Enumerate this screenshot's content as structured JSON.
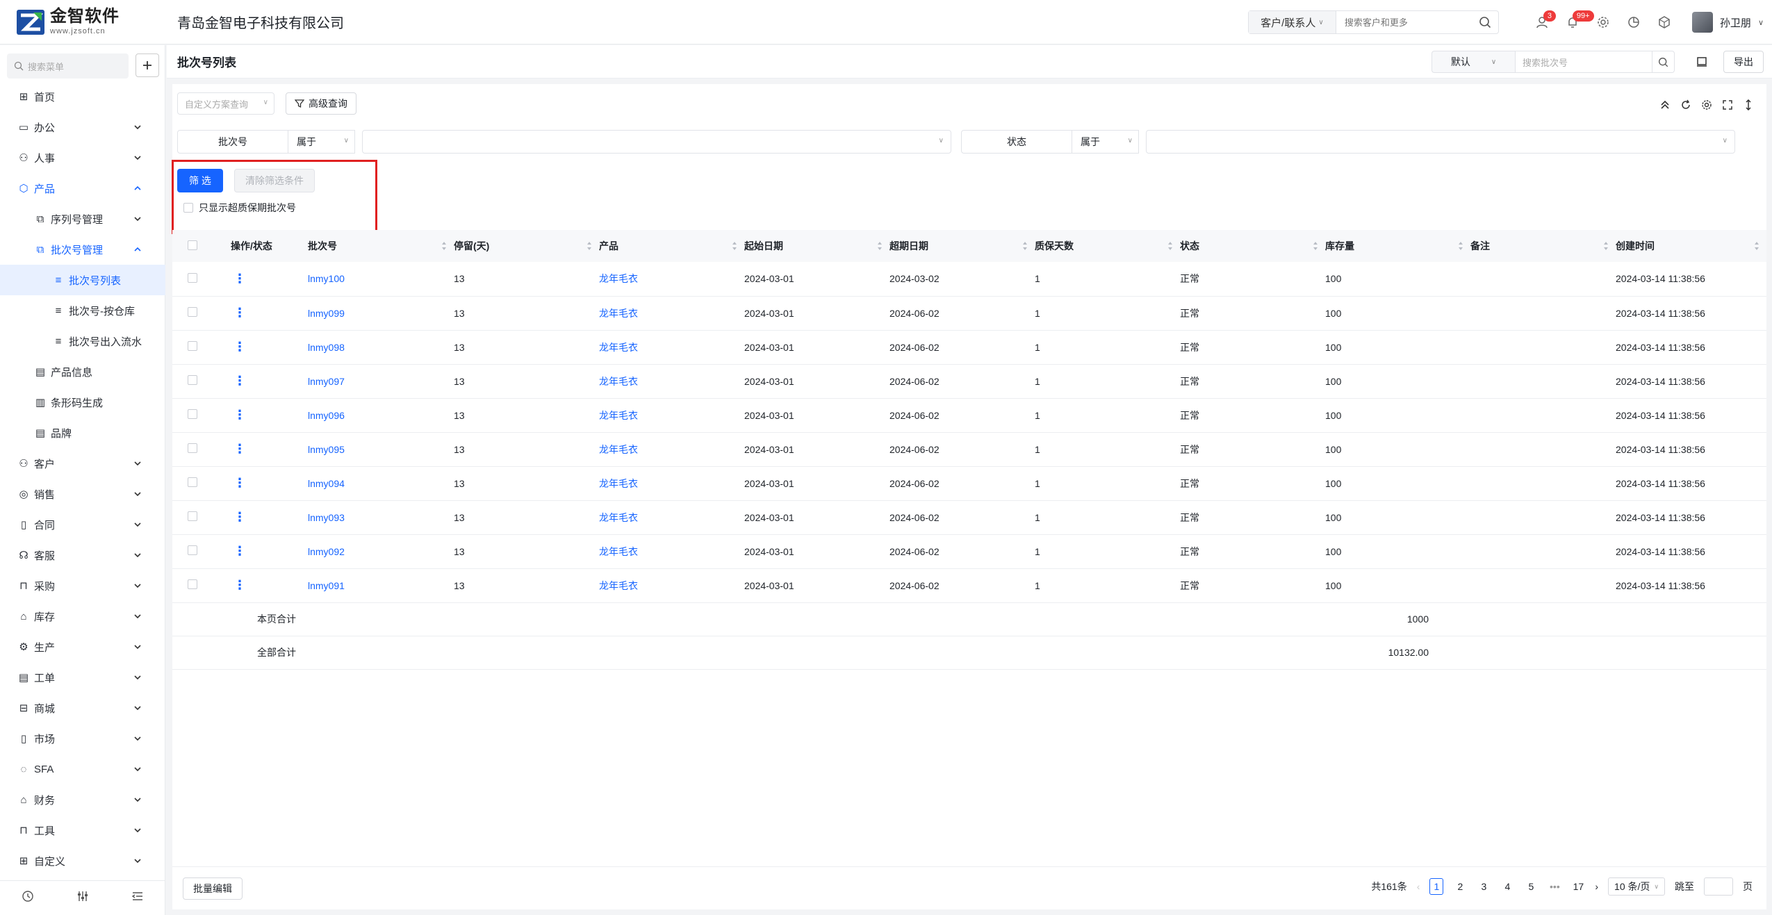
{
  "header": {
    "logo_cn": "金智软件",
    "logo_en": "www.jzsoft.cn",
    "company": "青岛金智电子科技有限公司",
    "search_scope": "客户/联系人",
    "search_placeholder": "搜索客户和更多",
    "badge_contacts": "3",
    "badge_notify": "99+",
    "user_name": "孙卫朋"
  },
  "sidebar": {
    "search_placeholder": "搜索菜单",
    "items": [
      {
        "label": "首页"
      },
      {
        "label": "办公"
      },
      {
        "label": "人事"
      },
      {
        "label": "产品"
      },
      {
        "label": "序列号管理"
      },
      {
        "label": "批次号管理"
      },
      {
        "label": "批次号列表"
      },
      {
        "label": "批次号-按仓库"
      },
      {
        "label": "批次号出入流水"
      },
      {
        "label": "产品信息"
      },
      {
        "label": "条形码生成"
      },
      {
        "label": "品牌"
      },
      {
        "label": "客户"
      },
      {
        "label": "销售"
      },
      {
        "label": "合同"
      },
      {
        "label": "客服"
      },
      {
        "label": "采购"
      },
      {
        "label": "库存"
      },
      {
        "label": "生产"
      },
      {
        "label": "工单"
      },
      {
        "label": "商城"
      },
      {
        "label": "市场"
      },
      {
        "label": "SFA"
      },
      {
        "label": "财务"
      },
      {
        "label": "工具"
      },
      {
        "label": "自定义"
      }
    ]
  },
  "titlebar": {
    "title": "批次号列表",
    "view_select": "默认",
    "search_placeholder": "搜索批次号",
    "export_label": "导出"
  },
  "toolbar": {
    "plan_placeholder": "自定义方案查询",
    "advanced_label": "高级查询"
  },
  "conditions": [
    {
      "field": "批次号",
      "op": "属于"
    },
    {
      "field": "状态",
      "op": "属于"
    }
  ],
  "filter": {
    "filter_label": "筛 选",
    "clear_label": "清除筛选条件",
    "checkbox_label": "只显示超质保期批次号"
  },
  "table": {
    "columns": [
      "操作/状态",
      "批次号",
      "停留(天)",
      "产品",
      "起始日期",
      "超期日期",
      "质保天数",
      "状态",
      "库存量",
      "备注",
      "创建时间"
    ],
    "rows": [
      {
        "batch": "lnmy100",
        "stay": "13",
        "product": "龙年毛衣",
        "start": "2024-03-01",
        "expire": "2024-03-02",
        "days": "1",
        "status": "正常",
        "stock": "100",
        "note": "",
        "created": "2024-03-14 11:38:56"
      },
      {
        "batch": "lnmy099",
        "stay": "13",
        "product": "龙年毛衣",
        "start": "2024-03-01",
        "expire": "2024-06-02",
        "days": "1",
        "status": "正常",
        "stock": "100",
        "note": "",
        "created": "2024-03-14 11:38:56"
      },
      {
        "batch": "lnmy098",
        "stay": "13",
        "product": "龙年毛衣",
        "start": "2024-03-01",
        "expire": "2024-06-02",
        "days": "1",
        "status": "正常",
        "stock": "100",
        "note": "",
        "created": "2024-03-14 11:38:56"
      },
      {
        "batch": "lnmy097",
        "stay": "13",
        "product": "龙年毛衣",
        "start": "2024-03-01",
        "expire": "2024-06-02",
        "days": "1",
        "status": "正常",
        "stock": "100",
        "note": "",
        "created": "2024-03-14 11:38:56"
      },
      {
        "batch": "lnmy096",
        "stay": "13",
        "product": "龙年毛衣",
        "start": "2024-03-01",
        "expire": "2024-06-02",
        "days": "1",
        "status": "正常",
        "stock": "100",
        "note": "",
        "created": "2024-03-14 11:38:56"
      },
      {
        "batch": "lnmy095",
        "stay": "13",
        "product": "龙年毛衣",
        "start": "2024-03-01",
        "expire": "2024-06-02",
        "days": "1",
        "status": "正常",
        "stock": "100",
        "note": "",
        "created": "2024-03-14 11:38:56"
      },
      {
        "batch": "lnmy094",
        "stay": "13",
        "product": "龙年毛衣",
        "start": "2024-03-01",
        "expire": "2024-06-02",
        "days": "1",
        "status": "正常",
        "stock": "100",
        "note": "",
        "created": "2024-03-14 11:38:56"
      },
      {
        "batch": "lnmy093",
        "stay": "13",
        "product": "龙年毛衣",
        "start": "2024-03-01",
        "expire": "2024-06-02",
        "days": "1",
        "status": "正常",
        "stock": "100",
        "note": "",
        "created": "2024-03-14 11:38:56"
      },
      {
        "batch": "lnmy092",
        "stay": "13",
        "product": "龙年毛衣",
        "start": "2024-03-01",
        "expire": "2024-06-02",
        "days": "1",
        "status": "正常",
        "stock": "100",
        "note": "",
        "created": "2024-03-14 11:38:56"
      },
      {
        "batch": "lnmy091",
        "stay": "13",
        "product": "龙年毛衣",
        "start": "2024-03-01",
        "expire": "2024-06-02",
        "days": "1",
        "status": "正常",
        "stock": "100",
        "note": "",
        "created": "2024-03-14 11:38:56"
      }
    ],
    "page_total_label": "本页合计",
    "page_total_value": "1000",
    "all_total_label": "全部合计",
    "all_total_value": "10132.00"
  },
  "footer": {
    "batch_edit_label": "批量编辑",
    "total_text": "共161条",
    "pages": [
      "1",
      "2",
      "3",
      "4",
      "5",
      "•••",
      "17"
    ],
    "page_size": "10 条/页",
    "jump_label": "跳至",
    "page_unit": "页"
  },
  "colors": {
    "accent": "#1664ff",
    "highlight_box": "#e02020",
    "badge": "#ee3b3b"
  }
}
